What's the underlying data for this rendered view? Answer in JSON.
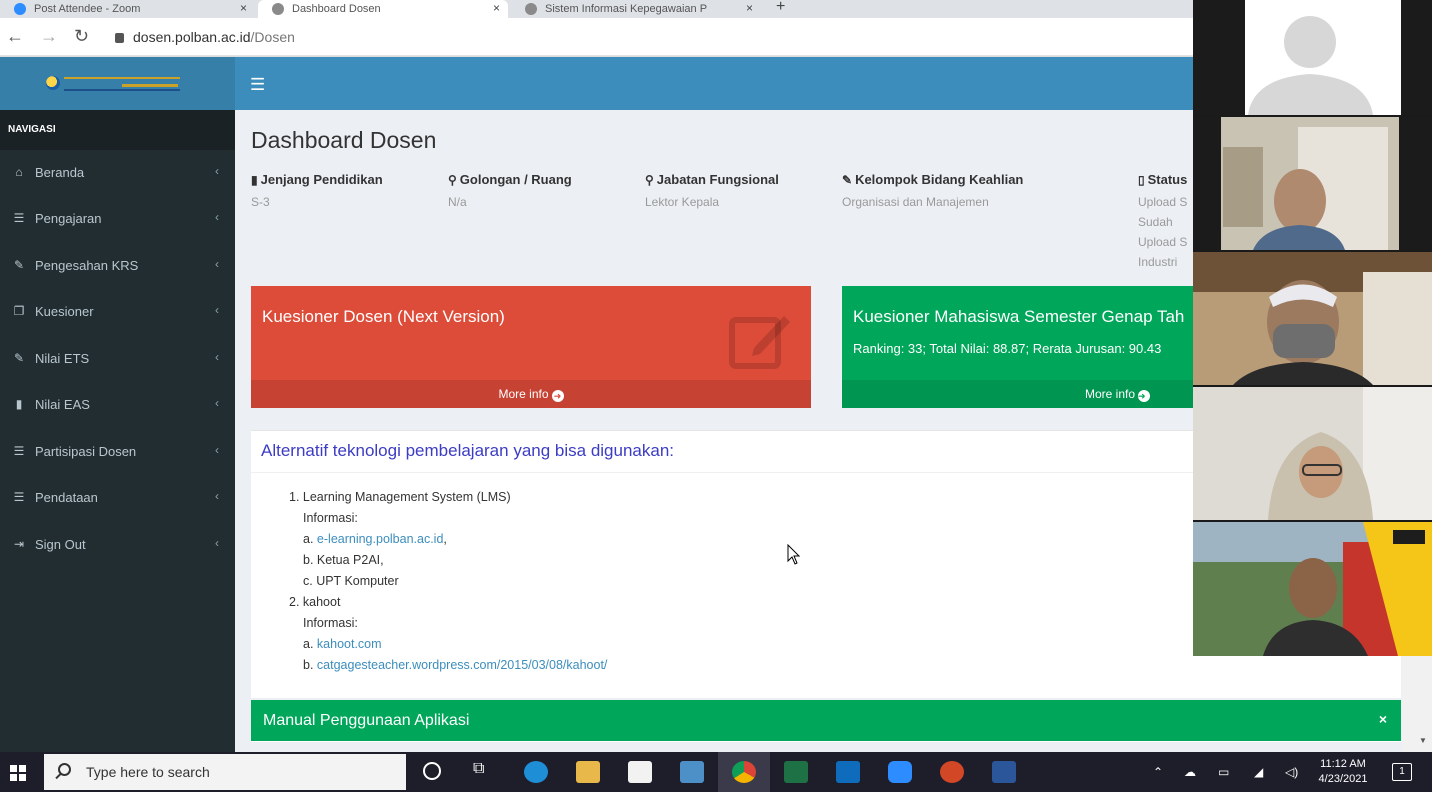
{
  "browser": {
    "tabs": [
      {
        "title": "Post Attendee - Zoom"
      },
      {
        "title": "Dashboard Dosen"
      },
      {
        "title": "Sistem Informasi Kepegawaian P"
      }
    ],
    "url_host": "dosen.polban.ac.id",
    "url_path": "/Dosen"
  },
  "header": {
    "menu_icon": "hamburger-icon"
  },
  "sidebar": {
    "header": "NAVIGASI",
    "items": [
      {
        "label": "Beranda",
        "icon": "home-icon"
      },
      {
        "label": "Pengajaran",
        "icon": "list-icon"
      },
      {
        "label": "Pengesahan KRS",
        "icon": "edit-icon"
      },
      {
        "label": "Kuesioner",
        "icon": "copy-icon"
      },
      {
        "label": "Nilai ETS",
        "icon": "edit-icon"
      },
      {
        "label": "Nilai EAS",
        "icon": "book-icon"
      },
      {
        "label": "Partisipasi Dosen",
        "icon": "list-icon"
      },
      {
        "label": "Pendataan",
        "icon": "list-icon"
      },
      {
        "label": "Sign Out",
        "icon": "sign-out-icon"
      }
    ]
  },
  "main": {
    "title": "Dashboard Dosen",
    "info": [
      {
        "label": "Jenjang Pendidikan",
        "value": "S-3",
        "icon": "book-icon"
      },
      {
        "label": "Golongan / Ruang",
        "value": "N/a",
        "icon": "map-marker-icon"
      },
      {
        "label": "Jabatan Fungsional",
        "value": "Lektor Kepala",
        "icon": "map-marker-icon"
      },
      {
        "label": "Kelompok Bidang Keahlian",
        "value": "Organisasi dan Manajemen",
        "icon": "pencil-icon"
      }
    ],
    "status": {
      "label": "Status",
      "lines": [
        "Upload S",
        "Sudah",
        "Upload S",
        "Industri"
      ]
    },
    "box_red": {
      "title": "Kuesioner Dosen (Next Version)",
      "more": "More info",
      "color": "#dd4b39"
    },
    "box_green": {
      "title": "Kuesioner Mahasiswa Semester Genap Tah",
      "subtitle": "Ranking: 33; Total Nilai: 88.87; Rerata Jurusan: 90.43",
      "more": "More info",
      "color": "#00a65a"
    },
    "alt_panel": {
      "title": "Alternatif teknologi pembelajaran yang bisa digunakan:",
      "item1": "1. Learning Management System (LMS)",
      "item1_info": "Informasi:",
      "item1_a_prefix": "a.",
      "item1_a_link": "e-learning.polban.ac.id",
      "item1_a_suffix": ",",
      "item1_b": "b. Ketua P2AI,",
      "item1_c": "c. UPT Komputer",
      "item2": "2. kahoot",
      "item2_info": "Informasi:",
      "item2_a_prefix": "a.",
      "item2_a_link": "kahoot.com",
      "item2_b_prefix": "b.",
      "item2_b_link": "catgagesteacher.wordpress.com/2015/03/08/kahoot/"
    },
    "manual": {
      "title": "Manual Penggunaan Aplikasi",
      "close": "×"
    }
  },
  "taskbar": {
    "search_placeholder": "Type here to search",
    "time": "11:12 AM",
    "date": "4/23/2021",
    "notifications": "1"
  },
  "colors": {
    "header_blue": "#3c8dbc",
    "sidebar_dark": "#222d32",
    "accent_red": "#dd4b39",
    "accent_green": "#00a65a",
    "link_blue": "#3c8dbc"
  }
}
